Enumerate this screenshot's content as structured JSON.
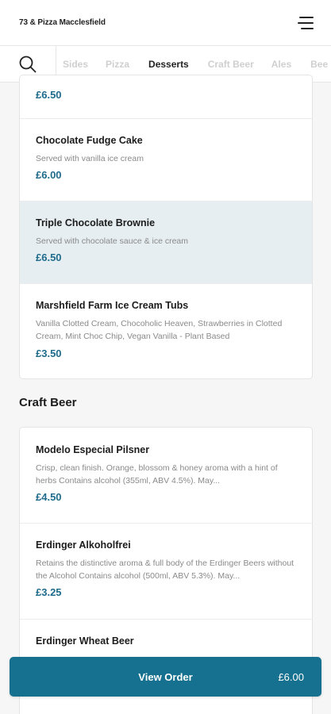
{
  "header": {
    "title": "73 & Pizza Macclesfield",
    "menu_icon": "hamburger-menu-icon"
  },
  "nav": {
    "search_icon": "search-icon",
    "tabs": [
      {
        "label": "Sides",
        "active": false
      },
      {
        "label": "Pizza",
        "active": false
      },
      {
        "label": "Desserts",
        "active": true
      },
      {
        "label": "Craft Beer",
        "active": false
      },
      {
        "label": "Ales",
        "active": false
      },
      {
        "label": "Bee",
        "active": false
      }
    ]
  },
  "desserts": {
    "items": [
      {
        "price": "£6.50"
      },
      {
        "name": "Chocolate Fudge Cake",
        "desc": "Served with vanilla ice cream",
        "price": "£6.00"
      },
      {
        "name": "Triple Chocolate Brownie",
        "desc": "Served with chocolate sauce & ice cream",
        "price": "£6.50"
      },
      {
        "name": "Marshfield Farm Ice Cream Tubs",
        "desc": "Vanilla Clotted Cream, Chocoholic Heaven, Strawberries in Clotted Cream, Mint Choc Chip, Vegan Vanilla - Plant Based",
        "price": "£3.50"
      }
    ]
  },
  "craft_beer": {
    "title": "Craft Beer",
    "items": [
      {
        "name": "Modelo Especial Pilsner",
        "desc": "Crisp, clean finish. Orange, blossom & honey aroma with a hint of herbs Contains alcohol (355ml, ABV 4.5%). May...",
        "price": "£4.50"
      },
      {
        "name": "Erdinger Alkoholfrei",
        "desc": "Retains the distinctive aroma & full body of the Erdinger Beers without the Alcohol Contains alcohol (500ml, ABV 5.3%). May...",
        "price": "£3.25"
      },
      {
        "name": "Erdinger Wheat Beer"
      }
    ]
  },
  "order_bar": {
    "label": "View Order",
    "total": "£6.00"
  },
  "colors": {
    "accent": "#15718f",
    "price": "#1f6b8c",
    "highlight": "#e6eef1"
  }
}
